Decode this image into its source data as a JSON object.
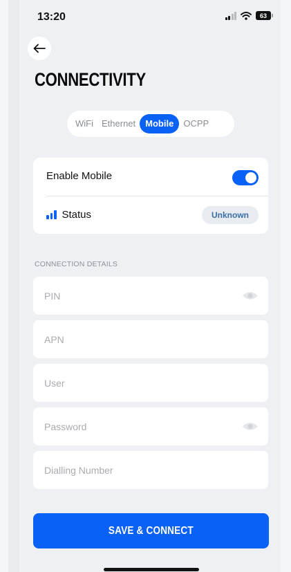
{
  "status_bar": {
    "time": "13:20",
    "battery": "63"
  },
  "header": {
    "title": "CONNECTIVITY"
  },
  "tabs": [
    {
      "label": "WiFi",
      "active": false
    },
    {
      "label": "Ethernet",
      "active": false
    },
    {
      "label": "Mobile",
      "active": true
    },
    {
      "label": "OCPP",
      "active": false
    }
  ],
  "mobile": {
    "enable_label": "Enable Mobile",
    "enabled": true,
    "status_label": "Status",
    "status_value": "Unknown"
  },
  "connection_details": {
    "section_label": "CONNECTION DETAILS",
    "fields": {
      "pin": {
        "placeholder": "PIN",
        "value": ""
      },
      "apn": {
        "placeholder": "APN",
        "value": ""
      },
      "user": {
        "placeholder": "User",
        "value": ""
      },
      "password": {
        "placeholder": "Password",
        "value": ""
      },
      "dialling_number": {
        "placeholder": "Dialling Number",
        "value": ""
      }
    }
  },
  "actions": {
    "save_label": "SAVE & CONNECT"
  },
  "colors": {
    "accent": "#0a61f5",
    "background": "#eef0f3",
    "card": "#ffffff",
    "badge_text": "#3a6ea8"
  },
  "icons": [
    "back-arrow-icon",
    "cellular-signal-icon",
    "wifi-icon",
    "battery-icon",
    "signal-bars-icon",
    "eye-icon"
  ]
}
